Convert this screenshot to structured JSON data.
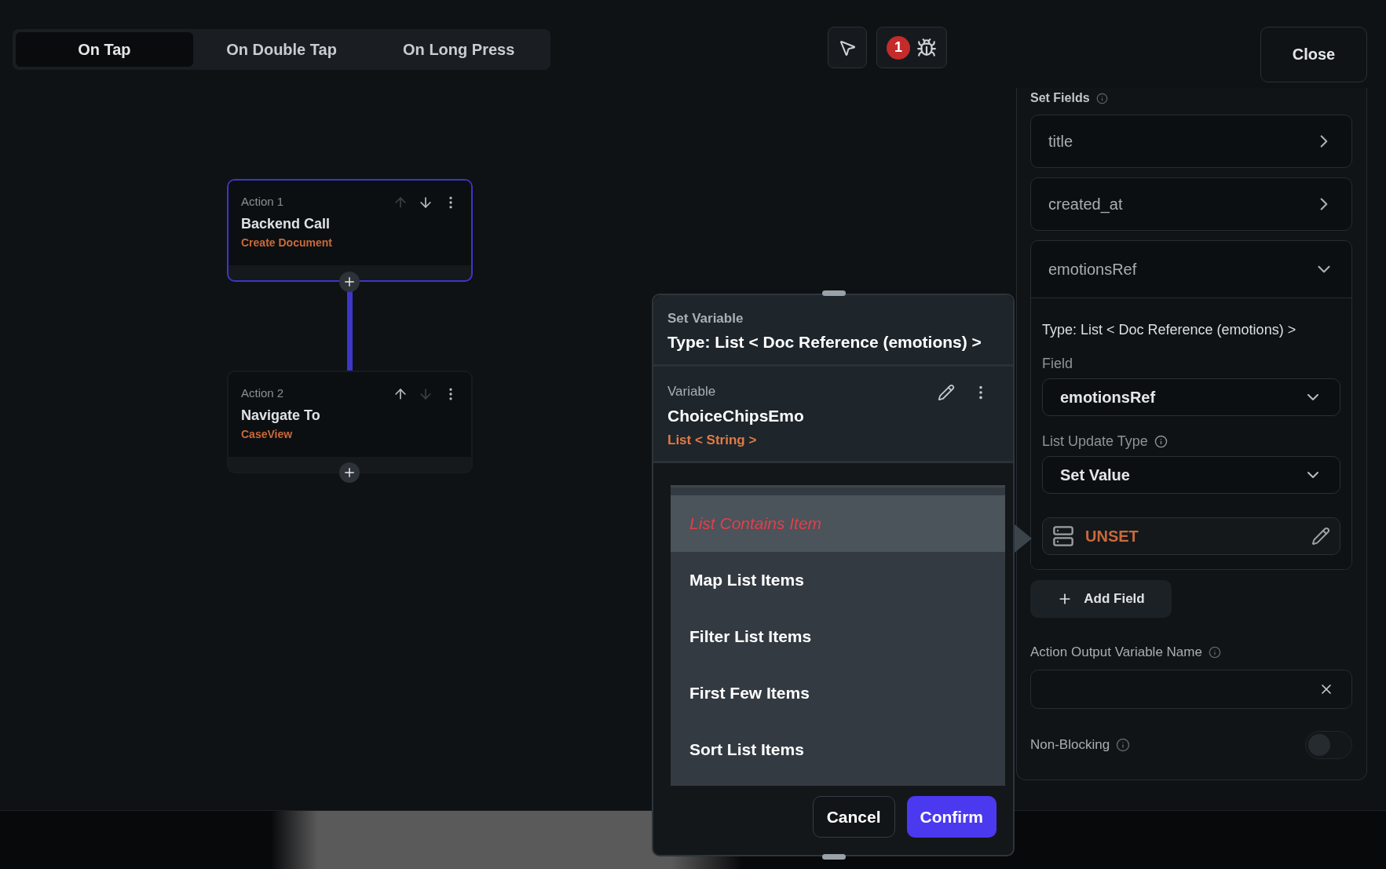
{
  "tabs": [
    {
      "label": "On Tap",
      "selected": true
    },
    {
      "label": "On Double Tap",
      "selected": false
    },
    {
      "label": "On Long Press",
      "selected": false
    }
  ],
  "toolbar": {
    "error_count": "1"
  },
  "close_button": "Close",
  "actions": [
    {
      "label": "Action 1",
      "title": "Backend Call",
      "subtitle": "Create Document",
      "selected": true,
      "can_move_up": false,
      "can_move_down": true
    },
    {
      "label": "Action 2",
      "title": "Navigate To",
      "subtitle": "CaseView",
      "selected": false,
      "can_move_up": true,
      "can_move_down": false
    }
  ],
  "dialog": {
    "heading": "Set Variable",
    "type": "Type: List < Doc Reference (emotions) >",
    "variable_label": "Variable",
    "variable_name": "ChoiceChipsEmo",
    "variable_type": "List < String >",
    "options": [
      {
        "label": "List Contains Item",
        "selected": true,
        "available": false
      },
      {
        "label": "Map List Items",
        "selected": false,
        "available": true
      },
      {
        "label": "Filter List Items",
        "selected": false,
        "available": true
      },
      {
        "label": "First Few Items",
        "selected": false,
        "available": true
      },
      {
        "label": "Sort List Items",
        "selected": false,
        "available": true
      }
    ],
    "buttons": [
      {
        "label": "Cancel",
        "kind": "secondary"
      },
      {
        "label": "Confirm",
        "kind": "primary"
      }
    ]
  },
  "panel": {
    "heading": "Set Fields",
    "fields": [
      {
        "name": "title",
        "expanded": false
      },
      {
        "name": "created_at",
        "expanded": false
      },
      {
        "name": "emotionsRef",
        "expanded": true,
        "type": "Type: List < Doc Reference (emotions) >",
        "field_label": "Field",
        "field_value": "emotionsRef",
        "update_label": "List Update Type",
        "update_value": "Set Value",
        "value": "UNSET"
      }
    ],
    "add_button": "Add Field",
    "output_label": "Action Output Variable Name",
    "non_blocking_label": "Non-Blocking",
    "non_blocking": false
  }
}
